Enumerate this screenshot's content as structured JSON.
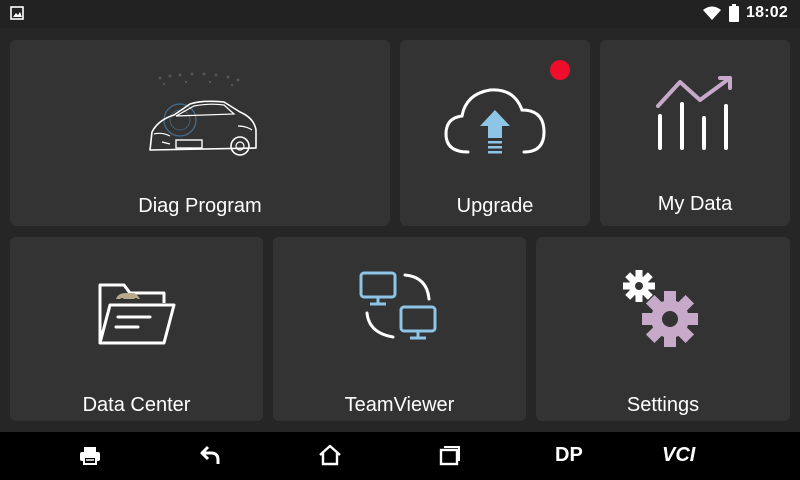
{
  "status_bar": {
    "time": "18:02",
    "icons": [
      "image-notification-icon",
      "wifi-icon",
      "battery-icon"
    ]
  },
  "tiles": {
    "diag_program": {
      "label": "Diag Program",
      "icon": "car-icon"
    },
    "upgrade": {
      "label": "Upgrade",
      "icon": "cloud-upload-icon",
      "has_notification": true
    },
    "my_data": {
      "label": "My Data",
      "icon": "bar-chart-icon"
    },
    "data_center": {
      "label": "Data Center",
      "icon": "folder-car-icon"
    },
    "teamviewer": {
      "label": "TeamViewer",
      "icon": "remote-monitors-icon"
    },
    "settings": {
      "label": "Settings",
      "icon": "gears-icon"
    }
  },
  "nav_bar": {
    "items": [
      {
        "name": "print-icon"
      },
      {
        "name": "back-icon"
      },
      {
        "name": "home-icon"
      },
      {
        "name": "recent-apps-icon"
      },
      {
        "label": "DP"
      },
      {
        "label": "VCI"
      }
    ]
  },
  "colors": {
    "background": "#262626",
    "tile": "#333333",
    "nav_bar": "#000000",
    "accent_blue": "#8ec4e6",
    "accent_purple": "#c7a9c9",
    "notification_red": "#ee0d2a"
  }
}
